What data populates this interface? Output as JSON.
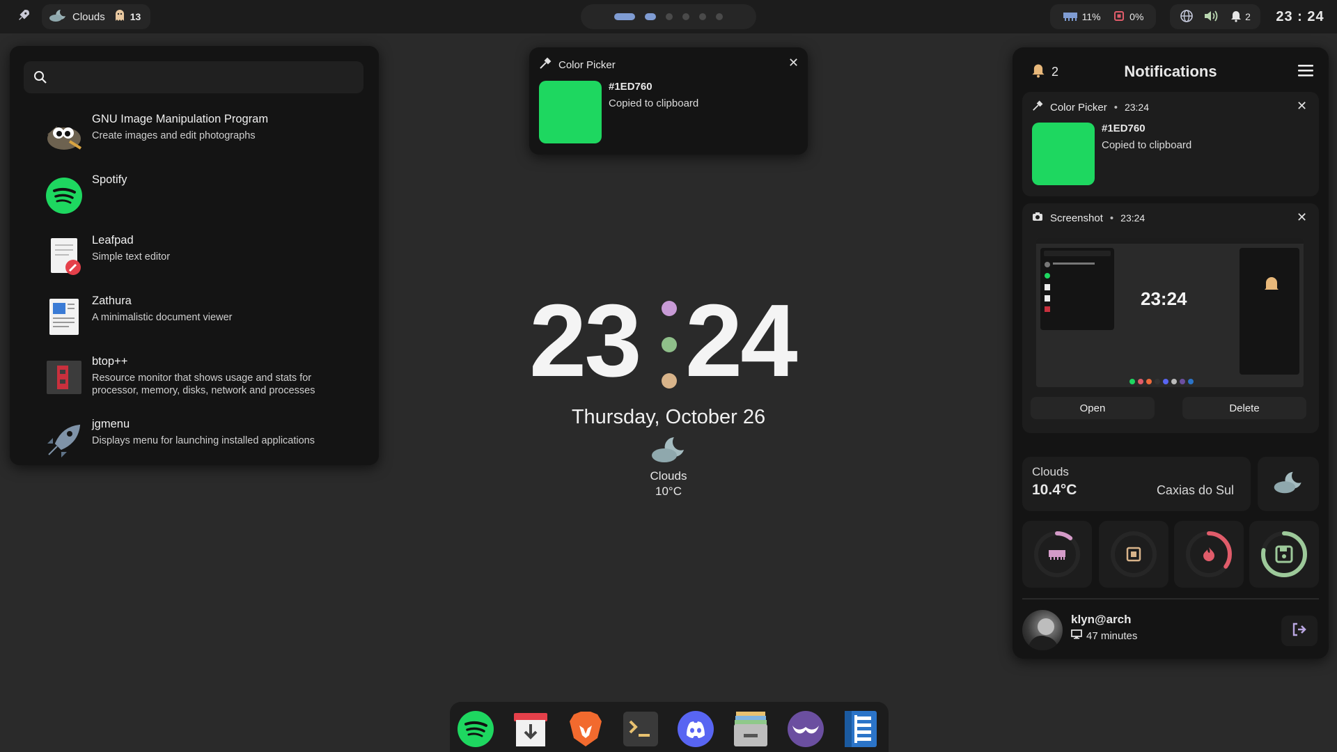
{
  "topbar": {
    "weather_label": "Clouds",
    "ghost_count": "13",
    "ram_percent": "11%",
    "cpu_percent": "0%",
    "notification_count": "2",
    "clock": "23 : 24"
  },
  "launcher": {
    "search_placeholder": "",
    "apps": [
      {
        "name": "GNU Image Manipulation Program",
        "desc": "Create images and edit photographs",
        "icon": "gimp-icon"
      },
      {
        "name": "Spotify",
        "desc": "",
        "icon": "spotify-icon"
      },
      {
        "name": "Leafpad",
        "desc": "Simple text editor",
        "icon": "leafpad-icon"
      },
      {
        "name": "Zathura",
        "desc": "A minimalistic document viewer",
        "icon": "zathura-icon"
      },
      {
        "name": "btop++",
        "desc": "Resource monitor that shows usage and stats for processor, memory, disks, network and processes",
        "icon": "btop-icon"
      },
      {
        "name": "jgmenu",
        "desc": "Displays menu for launching installed applications",
        "icon": "jgmenu-icon"
      }
    ]
  },
  "popup": {
    "title": "Color Picker",
    "hex": "#1ED760",
    "message": "Copied to clipboard",
    "swatch_color": "#1ED760"
  },
  "desktop": {
    "hours": "23",
    "minutes": "24",
    "date": "Thursday, October 26",
    "weather_condition": "Clouds",
    "weather_temp": "10°C",
    "colon_colors": [
      "#c89bd6",
      "#8fbf8a",
      "#d8b48a"
    ]
  },
  "notifications": {
    "count": "2",
    "title": "Notifications",
    "items": [
      {
        "app": "Color Picker",
        "time": "23:24",
        "hex": "#1ED760",
        "message": "Copied to clipboard"
      },
      {
        "app": "Screenshot",
        "time": "23:24",
        "open_label": "Open",
        "delete_label": "Delete"
      }
    ],
    "weather": {
      "condition": "Clouds",
      "temp": "10.4°C",
      "city": "Caxias do Sul"
    },
    "gauges": [
      {
        "name": "ram",
        "fraction": 0.11,
        "color": "#d49bc8"
      },
      {
        "name": "cpu",
        "fraction": 0.0,
        "color": "#d8b48a"
      },
      {
        "name": "temp",
        "fraction": 0.35,
        "color": "#e05c6a"
      },
      {
        "name": "disk",
        "fraction": 0.78,
        "color": "#9dc99a"
      }
    ],
    "user": {
      "name": "klyn@arch",
      "uptime": "47 minutes"
    }
  },
  "dock": {
    "apps": [
      "spotify-icon",
      "package-manager-icon",
      "brave-icon",
      "terminal-icon",
      "discord-icon",
      "files-icon",
      "mustache-app-icon",
      "text-editor-icon"
    ]
  },
  "colors": {
    "accent_green": "#1ED760",
    "accent_blue": "#7f9cd3",
    "panel_bg": "#141414",
    "desktop_bg": "#2a2a2a"
  }
}
